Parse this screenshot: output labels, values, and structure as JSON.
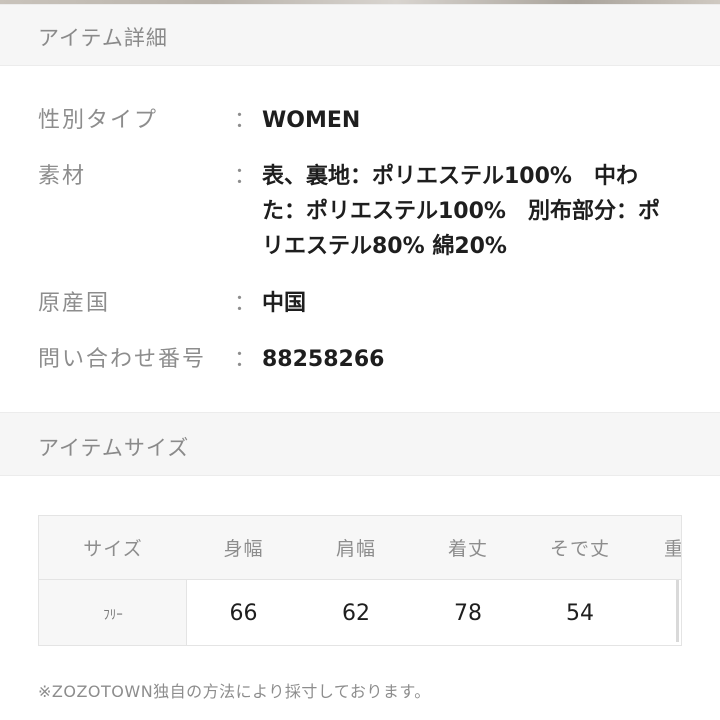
{
  "details_section": {
    "title": "アイテム詳細",
    "rows": [
      {
        "label": "性別タイプ",
        "separator": "：",
        "value": "WOMEN"
      },
      {
        "label": "素材",
        "separator": "：",
        "value": "表、裏地：ポリエステル100%　中わた：ポリエステル100%　別布部分：ポリエステル80% 綿20%"
      },
      {
        "label": "原産国",
        "separator": "：",
        "value": "中国"
      },
      {
        "label": "問い合わせ番号",
        "separator": "：",
        "value": "88258266"
      }
    ]
  },
  "size_section": {
    "title": "アイテムサイズ",
    "table": {
      "headers": [
        "サイズ",
        "身幅",
        "肩幅",
        "着丈",
        "そで丈",
        "重"
      ],
      "rows": [
        [
          "ﾌﾘｰ",
          "66",
          "62",
          "78",
          "54",
          ""
        ]
      ]
    },
    "footnote": "※ZOZOTOWN独自の方法により採寸しております。"
  }
}
